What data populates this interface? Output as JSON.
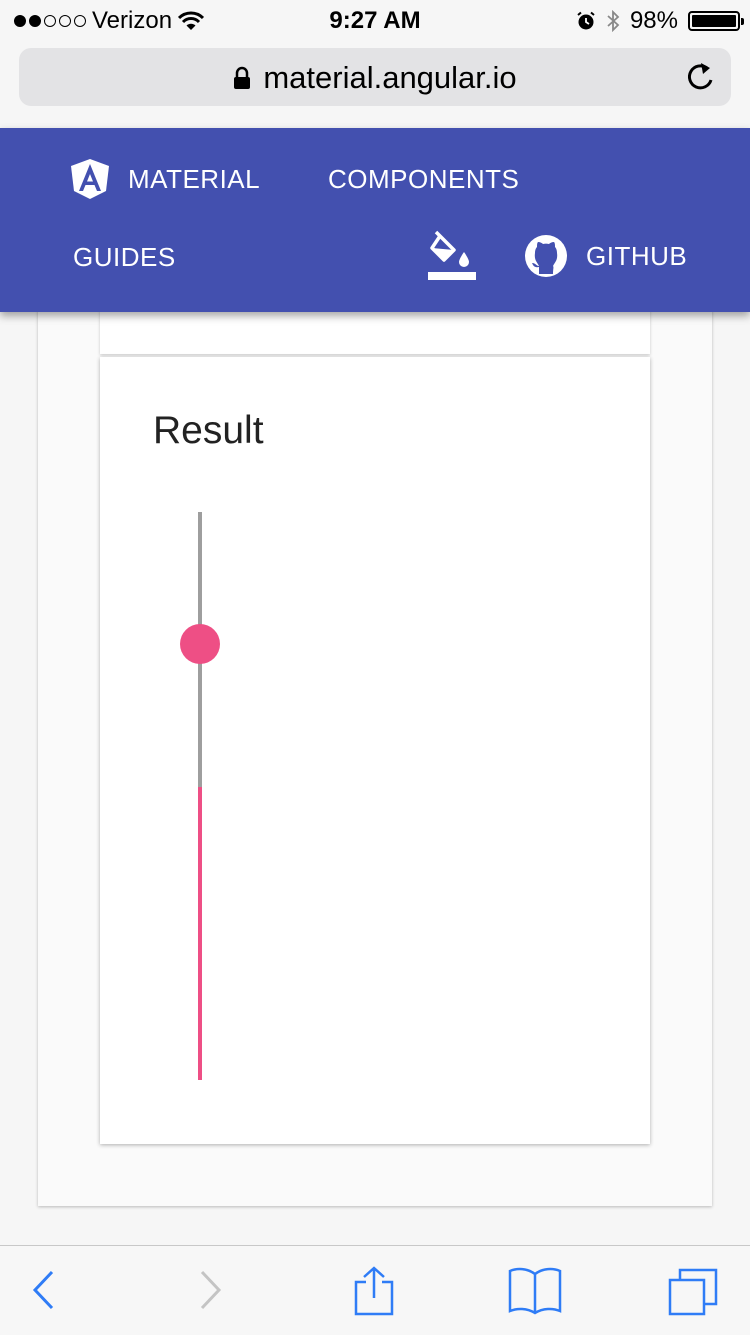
{
  "status_bar": {
    "carrier": "Verizon",
    "time": "9:27 AM",
    "battery": "98%",
    "battery_level": 0.98,
    "signal_bars": 2,
    "icons": [
      "wifi-icon",
      "alarm-icon",
      "bluetooth-icon",
      "battery-icon"
    ]
  },
  "browser": {
    "url": "material.angular.io",
    "icons": [
      "lock-icon",
      "reload-icon"
    ]
  },
  "header": {
    "brand_label": "MATERIAL",
    "components_label": "COMPONENTS",
    "guides_label": "GUIDES",
    "github_label": "GITHUB",
    "icons": [
      "angular-logo-icon",
      "theme-picker-icon",
      "github-icon"
    ],
    "color": "#4350af"
  },
  "result_card": {
    "title": "Result",
    "slider": {
      "orientation": "vertical",
      "value_fraction": 0.52,
      "thumb_position_fraction": 0.2,
      "accent_color": "#ee4f85",
      "track_color": "#9e9e9e"
    }
  },
  "toolbar": {
    "icons": [
      "back-icon",
      "forward-icon",
      "share-icon",
      "bookmarks-icon",
      "tabs-icon"
    ],
    "accent_color": "#2f7cf6"
  }
}
